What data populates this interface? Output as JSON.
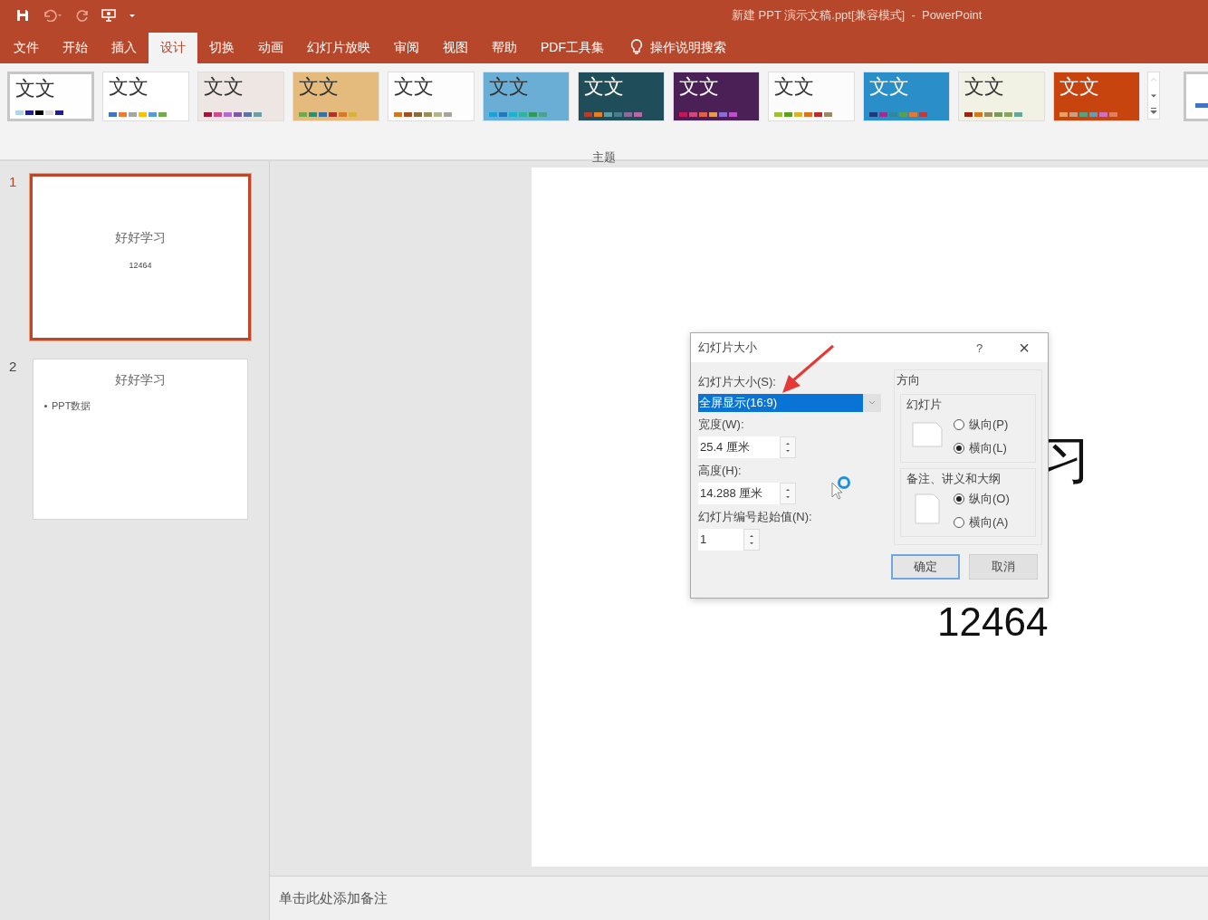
{
  "window": {
    "title": "新建 PPT 演示文稿.ppt[兼容模式]  -  PowerPoint"
  },
  "ribbon_tabs": [
    {
      "label": "文件",
      "selected": false
    },
    {
      "label": "开始",
      "selected": false
    },
    {
      "label": "插入",
      "selected": false
    },
    {
      "label": "设计",
      "selected": true
    },
    {
      "label": "切换",
      "selected": false
    },
    {
      "label": "动画",
      "selected": false
    },
    {
      "label": "幻灯片放映",
      "selected": false
    },
    {
      "label": "审阅",
      "selected": false
    },
    {
      "label": "视图",
      "selected": false
    },
    {
      "label": "帮助",
      "selected": false
    },
    {
      "label": "PDF工具集",
      "selected": false
    }
  ],
  "tell_me": {
    "placeholder": "操作说明搜索"
  },
  "themes": {
    "group_label": "主题",
    "items": [
      {
        "label": "文文",
        "selected": true,
        "color": "#fefefe",
        "swatches": [
          {
            "color": "#add8e6"
          },
          {
            "color": "#1f1f8f"
          },
          {
            "color": "#000000"
          },
          {
            "color": "#dddddd"
          },
          {
            "color": "#1f1f8f"
          }
        ]
      },
      {
        "label": "文文",
        "selected": false,
        "color": "#ffffff",
        "swatches": [
          {
            "color": "#4472c4"
          },
          {
            "color": "#ed7d31"
          },
          {
            "color": "#a5a5a5"
          },
          {
            "color": "#ffc000"
          },
          {
            "color": "#5b9bd5"
          },
          {
            "color": "#70ad47"
          }
        ]
      },
      {
        "label": "文文",
        "selected": false,
        "color": "#ede6e3",
        "swatches": [
          {
            "color": "#a5123c"
          },
          {
            "color": "#d04a8f"
          },
          {
            "color": "#b46ad6"
          },
          {
            "color": "#7b5ba6"
          },
          {
            "color": "#5b74a8"
          },
          {
            "color": "#6e9fa5"
          }
        ]
      },
      {
        "label": "文文",
        "selected": false,
        "color": "#e4bb7c",
        "swatches": [
          {
            "color": "#74a84a"
          },
          {
            "color": "#2e8f6c"
          },
          {
            "color": "#3872a5"
          },
          {
            "color": "#b2322a"
          },
          {
            "color": "#d47a2b"
          },
          {
            "color": "#d9b234"
          }
        ]
      },
      {
        "label": "文文",
        "selected": false,
        "color": "#fdfdfd",
        "swatches": [
          {
            "color": "#d4761c"
          },
          {
            "color": "#a54e1e"
          },
          {
            "color": "#8a6a3a"
          },
          {
            "color": "#9c8c5c"
          },
          {
            "color": "#b5b58a"
          },
          {
            "color": "#a5a59a"
          }
        ]
      },
      {
        "label": "文文",
        "selected": false,
        "color": "#6aaed6",
        "swatches": [
          {
            "color": "#1ca0d8"
          },
          {
            "color": "#1d7bbd"
          },
          {
            "color": "#1bb3c9"
          },
          {
            "color": "#2bb59a"
          },
          {
            "color": "#2e9a58"
          },
          {
            "color": "#4aa38f"
          }
        ]
      },
      {
        "label": "文文",
        "selected": false,
        "color": "#1f4e5a",
        "swatches": [
          {
            "color": "#c0392b"
          },
          {
            "color": "#e67e22"
          },
          {
            "color": "#5f9ea0"
          },
          {
            "color": "#4a7c8c"
          },
          {
            "color": "#8c6a9c"
          },
          {
            "color": "#b56aa5"
          }
        ]
      },
      {
        "label": "文文",
        "selected": false,
        "color": "#4b2057",
        "swatches": [
          {
            "color": "#c2185b"
          },
          {
            "color": "#d4457a"
          },
          {
            "color": "#e0604a"
          },
          {
            "color": "#e89a4a"
          },
          {
            "color": "#8e6ad6"
          },
          {
            "color": "#c44ad0"
          }
        ]
      },
      {
        "label": "文文",
        "selected": false,
        "color": "#fcfcfc",
        "swatches": [
          {
            "color": "#9cc42a"
          },
          {
            "color": "#5e9e1e"
          },
          {
            "color": "#e0b020"
          },
          {
            "color": "#e07020"
          },
          {
            "color": "#c02a2a"
          },
          {
            "color": "#9a8a6a"
          }
        ]
      },
      {
        "label": "文文",
        "selected": false,
        "color": "#2a8fc8",
        "swatches": [
          {
            "color": "#1a3a7a"
          },
          {
            "color": "#a52a8a"
          },
          {
            "color": "#2a8a9a"
          },
          {
            "color": "#5aa04a"
          },
          {
            "color": "#e07a3a"
          },
          {
            "color": "#c03a3a"
          }
        ]
      },
      {
        "label": "文文",
        "selected": false,
        "color": "#f1f1e4",
        "swatches": [
          {
            "color": "#a5200e"
          },
          {
            "color": "#d4761c"
          },
          {
            "color": "#9c8c5c"
          },
          {
            "color": "#7a9a5a"
          },
          {
            "color": "#8aa55a"
          },
          {
            "color": "#6aa59a"
          }
        ]
      },
      {
        "label": "文文",
        "selected": false,
        "color": "#c8440f",
        "swatches": [
          {
            "color": "#e8a060"
          },
          {
            "color": "#c8a080"
          },
          {
            "color": "#5aa07a"
          },
          {
            "color": "#6a9ab0"
          },
          {
            "color": "#d070c0"
          },
          {
            "color": "#e08060"
          }
        ]
      }
    ]
  },
  "slides": [
    {
      "number": "1",
      "selected": true,
      "title": "好好学习",
      "subtitle": "12464"
    },
    {
      "number": "2",
      "selected": false,
      "title": "好好学习",
      "bullets": [
        "PPT数据"
      ]
    }
  ],
  "canvas": {
    "title_visible": "习",
    "subtitle": "12464"
  },
  "notes": {
    "placeholder": "单击此处添加备注"
  },
  "dialog": {
    "title": "幻灯片大小",
    "help": "?",
    "close": "×",
    "size_label": "幻灯片大小(S):",
    "size_value": "全屏显示(16:9)",
    "width_label": "宽度(W):",
    "width_value": "25.4 厘米",
    "height_label": "高度(H):",
    "height_value": "14.288 厘米",
    "start_label": "幻灯片编号起始值(N):",
    "start_value": "1",
    "orientation_label": "方向",
    "groups": [
      {
        "label": "幻灯片",
        "options": [
          {
            "label": "纵向(P)",
            "checked": false
          },
          {
            "label": "横向(L)",
            "checked": true
          }
        ]
      },
      {
        "label": "备注、讲义和大纲",
        "options": [
          {
            "label": "纵向(O)",
            "checked": true
          },
          {
            "label": "横向(A)",
            "checked": false
          }
        ]
      }
    ],
    "buttons": [
      {
        "label": "确定",
        "default": true
      },
      {
        "label": "取消",
        "default": false
      }
    ]
  }
}
